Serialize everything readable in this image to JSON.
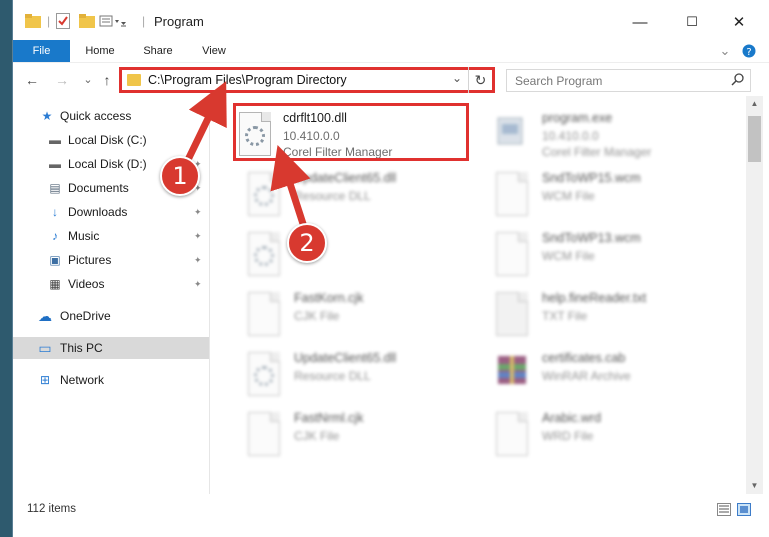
{
  "window": {
    "title": "Program",
    "controls": {
      "minimize": "—",
      "maximize": "☐",
      "close": "✕"
    }
  },
  "ribbon": {
    "tabs": [
      "File",
      "Home",
      "Share",
      "View"
    ],
    "expand_glyph": "⌄",
    "help_glyph": "?"
  },
  "address_bar": {
    "path": "C:\\Program Files\\Program Directory",
    "refresh_glyph": "↻",
    "dropdown_glyph": "⌄"
  },
  "nav_buttons": {
    "back": "←",
    "forward": "→",
    "recent": "⌄",
    "up": "↑"
  },
  "search": {
    "placeholder": "Search Program",
    "icon_glyph": "⌕"
  },
  "sidebar": {
    "items": [
      {
        "label": "Quick access",
        "icon": "star-icon",
        "glyph": "★",
        "color": "#2b7cd3"
      },
      {
        "label": "Local Disk (C:)",
        "icon": "disk-icon",
        "glyph": "▬",
        "color": "#666666"
      },
      {
        "label": "Local Disk (D:)",
        "icon": "disk-icon",
        "glyph": "▬",
        "color": "#666666"
      },
      {
        "label": "Documents",
        "icon": "documents-icon",
        "glyph": "▤",
        "color": "#5a6b7c"
      },
      {
        "label": "Downloads",
        "icon": "download-icon",
        "glyph": "↓",
        "color": "#2b7cd3"
      },
      {
        "label": "Music",
        "icon": "music-icon",
        "glyph": "♪",
        "color": "#2b7cd3"
      },
      {
        "label": "Pictures",
        "icon": "pictures-icon",
        "glyph": "▣",
        "color": "#3d6fa3"
      },
      {
        "label": "Videos",
        "icon": "videos-icon",
        "glyph": "▦",
        "color": "#444444"
      },
      {
        "label": "OneDrive",
        "icon": "cloud-icon",
        "glyph": "☁",
        "color": "#1f6fc4"
      },
      {
        "label": "This PC",
        "icon": "computer-icon",
        "glyph": "▭",
        "color": "#2b7cd3"
      },
      {
        "label": "Network",
        "icon": "network-icon",
        "glyph": "⊞",
        "color": "#2b7cd3"
      }
    ],
    "pin_glyph": "✦"
  },
  "files": {
    "highlighted": {
      "name": "cdrflt100.dll",
      "version": "10.410.0.0",
      "description": "Corel Filter Manager"
    },
    "left_column": [
      {
        "name": "UpdateClient65.dll",
        "type": "Resource DLL"
      },
      {
        "name": "",
        "type": ""
      },
      {
        "name": "FastKorn.cjk",
        "type": "CJK File"
      },
      {
        "name": "UpdateClient65.dll",
        "type": "Resource DLL"
      },
      {
        "name": "FastNrml.cjk",
        "type": "CJK File"
      }
    ],
    "right_column": [
      {
        "name": "program.exe",
        "line2": "10.410.0.0",
        "line3": "Corel Filter Manager"
      },
      {
        "name": "SndToWP15.wcm",
        "line2": "WCM File"
      },
      {
        "name": "SndToWP13.wcm",
        "line2": "WCM File"
      },
      {
        "name": "help.fineReader.txt",
        "line2": "TXT File"
      },
      {
        "name": "certificates.cab",
        "line2": "WinRAR Archive"
      },
      {
        "name": "Arabic.wrd",
        "line2": "WRD File"
      }
    ]
  },
  "status_bar": {
    "item_count": "112 items"
  },
  "annotations": {
    "badge1": "1",
    "badge2": "2",
    "color": "#d8392f"
  }
}
